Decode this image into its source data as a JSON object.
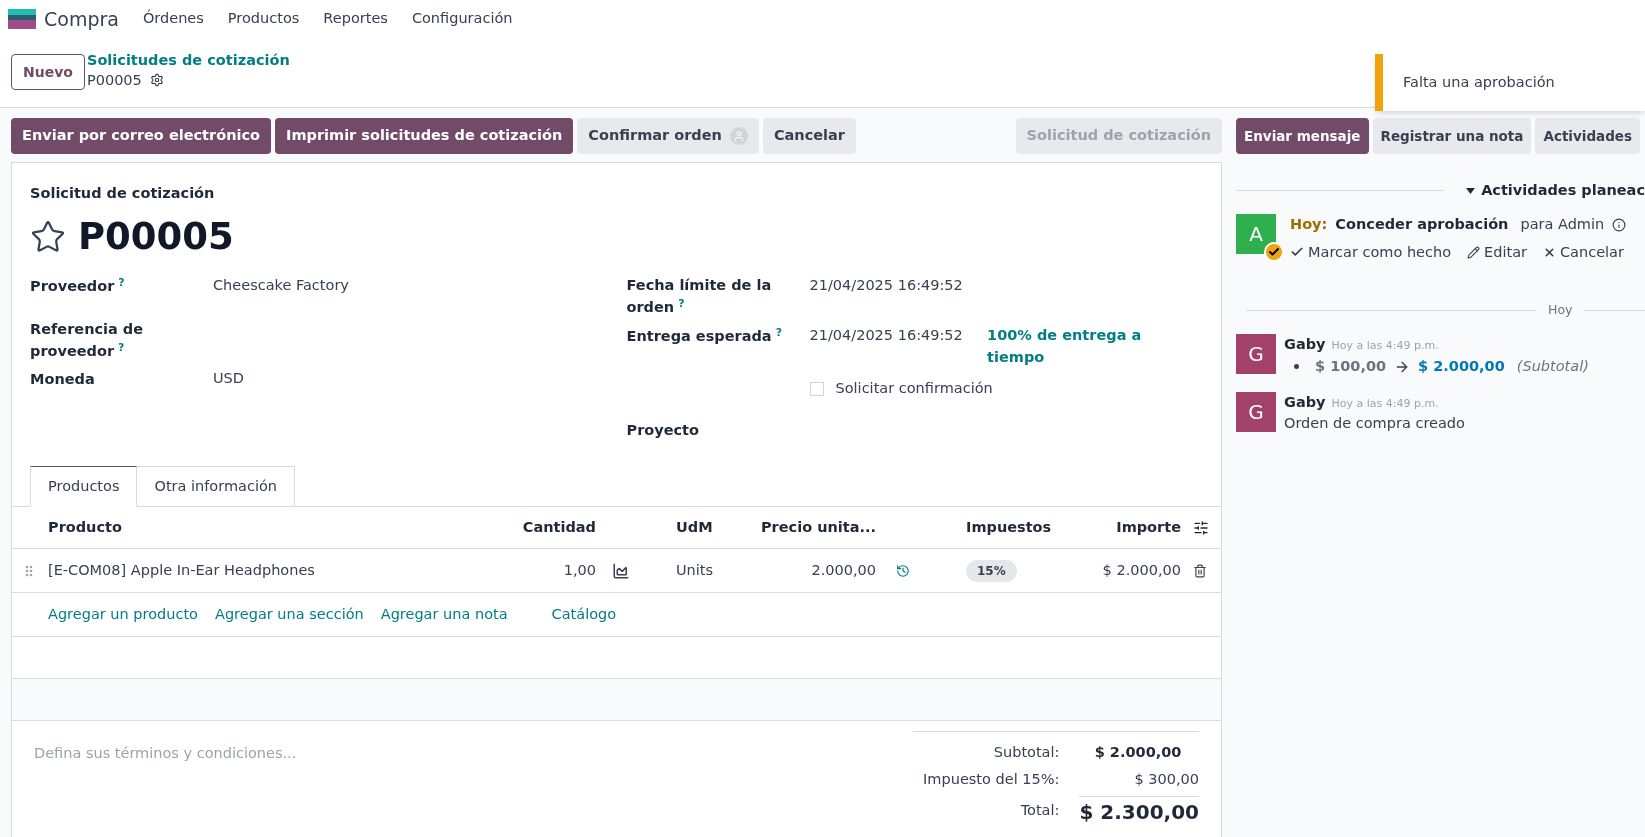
{
  "app": {
    "name": "Compra",
    "menu": [
      "Órdenes",
      "Productos",
      "Reportes",
      "Configuración"
    ]
  },
  "control_panel": {
    "new_button": "Nuevo",
    "breadcrumb": "Solicitudes de cotización",
    "record": "P00005"
  },
  "toast": {
    "message": "Falta una aprobación"
  },
  "actions": [
    {
      "label": "Enviar por correo electrónico",
      "kind": "primary"
    },
    {
      "label": "Imprimir solicitudes de cotización",
      "kind": "primary"
    },
    {
      "label": "Confirmar orden",
      "kind": "avatar"
    },
    {
      "label": "Cancelar",
      "kind": "secondary"
    }
  ],
  "status": {
    "label": "Solicitud de cotización",
    "selected": true
  },
  "form": {
    "subtitle": "Solicitud de cotización",
    "title": "P00005",
    "starred": false,
    "left_fields": [
      {
        "label": "Proveedor",
        "help": "?",
        "value": "Cheescake Factory"
      },
      {
        "label": "Referencia de proveedor",
        "help": "?"
      },
      {
        "label": "Moneda",
        "value": "USD"
      }
    ],
    "right_fields": [
      {
        "label": "Fecha límite de la orden",
        "help": "?",
        "value": "21/04/2025 16:49:52"
      },
      {
        "label": "Entrega esperada",
        "help": "?",
        "value": "21/04/2025 16:49:52",
        "extra": "100% de entrega a tiempo"
      }
    ],
    "checkbox": {
      "label": "Solicitar confirmación",
      "checked": false
    },
    "project_label": "Proyecto"
  },
  "tabs": [
    {
      "label": "Productos",
      "selected": true
    },
    {
      "label": "Otra información",
      "selected": false
    }
  ],
  "table": {
    "columns": [
      "Producto",
      "Cantidad",
      "UdM",
      "Precio unita...",
      "Impuestos",
      "Importe"
    ],
    "rows": [
      {
        "product": "[E-COM08] Apple In-Ear Headphones",
        "quantity": "1,00",
        "uom": "Units",
        "price": "2.000,00",
        "tax": "15%",
        "amount": "$ 2.000,00"
      }
    ],
    "add_links": [
      "Agregar un producto",
      "Agregar una sección",
      "Agregar una nota",
      "Catálogo"
    ]
  },
  "terms": {
    "placeholder": "Defina sus términos y condiciones..."
  },
  "totals": {
    "subtotal_label": "Subtotal:",
    "subtotal": "$ 2.000,00",
    "tax_label": "Impuesto del 15%:",
    "tax": "$ 300,00",
    "total_label": "Total:",
    "total": "$ 2.300,00"
  },
  "chatter": {
    "buttons": [
      {
        "label": "Enviar mensaje",
        "kind": "primary"
      },
      {
        "label": "Registrar una nota",
        "kind": "secondary"
      },
      {
        "label": "Actividades",
        "kind": "secondary"
      }
    ],
    "activities_header": "Actividades planeac",
    "activities_expanded": true,
    "activity": {
      "avatar": "A",
      "due": "Hoy:",
      "title": "Conceder aprobación",
      "assignee": "para Admin",
      "actions": [
        "Marcar como hecho",
        "Editar",
        "Cancelar"
      ]
    },
    "separator": "Hoy",
    "messages": [
      {
        "avatar": "G",
        "author": "Gaby",
        "time": "Hoy a las 4:49 p.m.",
        "kind": "tracking",
        "old": "$ 100,00",
        "new": "$ 2.000,00",
        "field": "(Subtotal)"
      },
      {
        "avatar": "G",
        "author": "Gaby",
        "time": "Hoy a las 4:49 p.m.",
        "kind": "text",
        "body": "Orden de compra creado"
      }
    ]
  }
}
